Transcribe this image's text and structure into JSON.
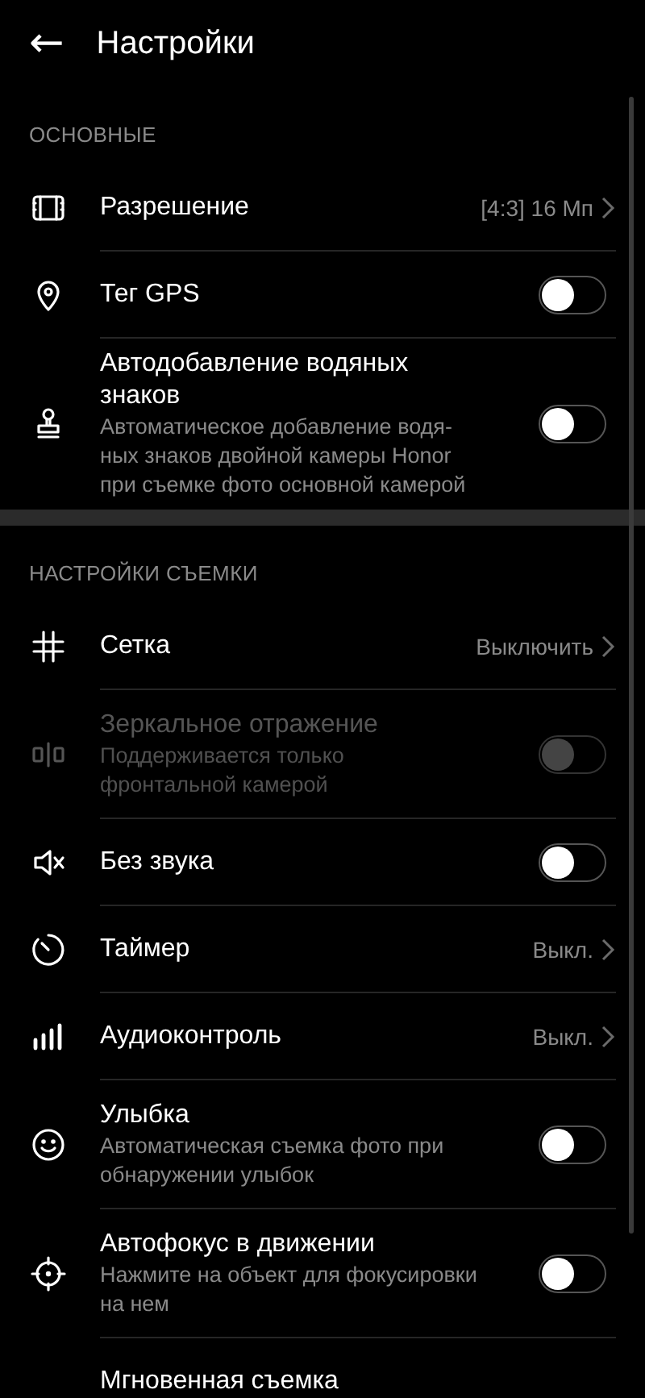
{
  "header": {
    "back": "←",
    "title": "Настройки"
  },
  "sections": [
    {
      "title": "ОСНОВНЫЕ",
      "rows": [
        {
          "kind": "value",
          "label": "Разрешение",
          "value": "[4:3] 16 Мп"
        },
        {
          "kind": "toggle",
          "label": "Тег GPS",
          "on": false,
          "disabled": false
        },
        {
          "kind": "toggle",
          "label": "Автодобавление водяных\nзнаков",
          "description": "Автоматическое добавление водя-\nных знаков двойной камеры Honor\nпри съемке фото основной камерой",
          "on": false,
          "disabled": false
        }
      ]
    },
    {
      "title": "НАСТРОЙКИ СЪЕМКИ",
      "rows": [
        {
          "kind": "value",
          "label": "Сетка",
          "value": "Выключить"
        },
        {
          "kind": "toggle",
          "label": "Зеркальное отражение",
          "description": "Поддерживается только\nфронтальной камерой",
          "on": false,
          "disabled": true
        },
        {
          "kind": "toggle",
          "label": "Без звука",
          "on": false,
          "disabled": false
        },
        {
          "kind": "value",
          "label": "Таймер",
          "value": "Выкл."
        },
        {
          "kind": "value",
          "label": "Аудиоконтроль",
          "value": "Выкл."
        },
        {
          "kind": "toggle",
          "label": "Улыбка",
          "description": "Автоматическая съемка фото при\nобнаружении улыбок",
          "on": false,
          "disabled": false
        },
        {
          "kind": "toggle",
          "label": "Автофокус в движении",
          "description": "Нажмите на объект для фокусировки\nна нем",
          "on": false,
          "disabled": false
        },
        {
          "kind": "plain",
          "label": "Мгновенная съемка"
        }
      ]
    }
  ]
}
